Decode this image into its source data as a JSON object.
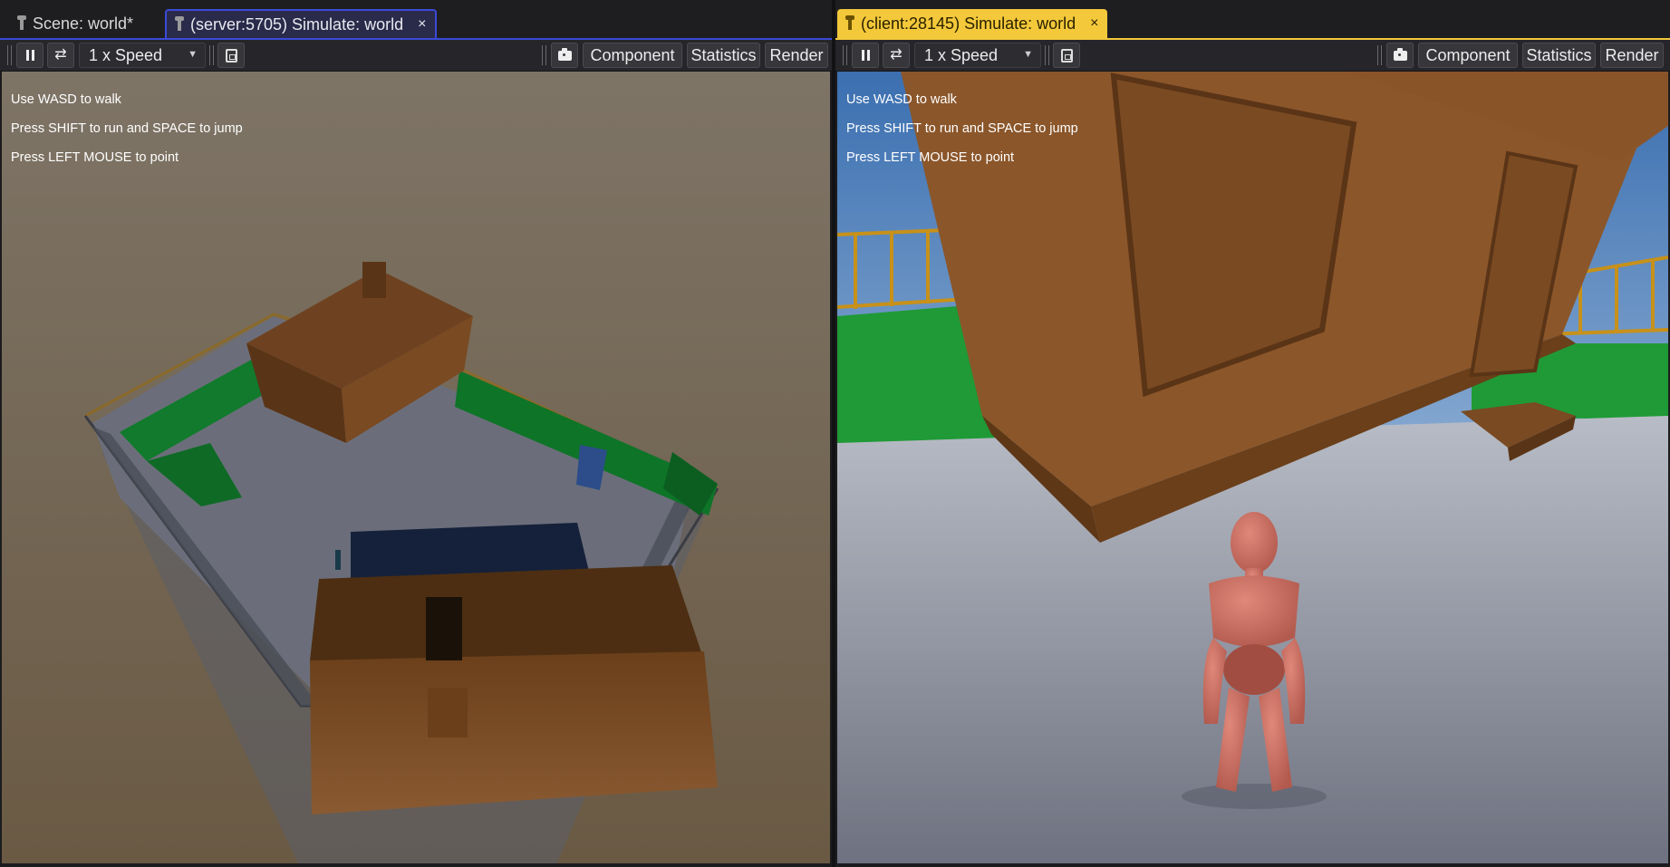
{
  "left_pane": {
    "tabs": [
      {
        "label": "Scene: world*"
      },
      {
        "label": "(server:5705) Simulate: world",
        "close": "×"
      }
    ],
    "toolbar": {
      "speed": "1 x Speed",
      "component_label": "Component",
      "statistics_label": "Statistics",
      "render_label": "Render"
    },
    "hints": [
      "Use WASD to walk",
      "Press SHIFT to run and SPACE to jump",
      "Press LEFT MOUSE to point"
    ]
  },
  "right_pane": {
    "tabs": [
      {
        "label": "(client:28145) Simulate: world",
        "close": "×"
      }
    ],
    "toolbar": {
      "speed": "1 x Speed",
      "component_label": "Component",
      "statistics_label": "Statistics",
      "render_label": "Render"
    },
    "hints": [
      "Use WASD to walk",
      "Press SHIFT to run and SPACE to jump",
      "Press LEFT MOUSE to point"
    ]
  },
  "colors": {
    "server_tab": "#3a4ad8",
    "client_tab": "#f3c83a",
    "wood": "#7a4a22",
    "grass": "#0f7a2a",
    "floor": "#6a6d78",
    "character": "#c96a5e"
  }
}
